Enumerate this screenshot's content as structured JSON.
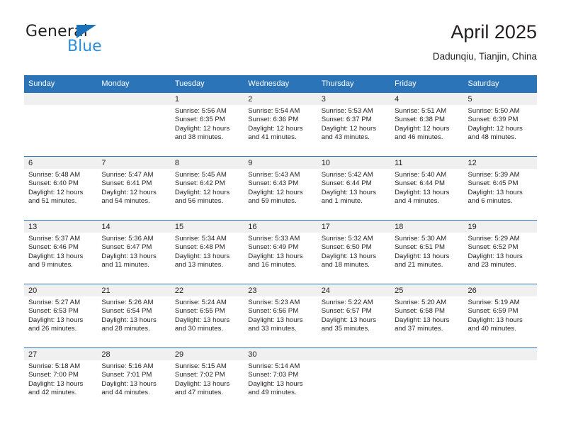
{
  "brand": {
    "name_top": "General",
    "name_bottom": "Blue",
    "triangle_color": "#1b72b8",
    "blue_color": "#2e8fd6"
  },
  "header": {
    "title": "April 2025",
    "subtitle": "Dadunqiu, Tianjin, China"
  },
  "theme": {
    "header_blue": "#2b74b8",
    "daynum_band": "#f0f0f0",
    "text": "#231f20"
  },
  "calendar": {
    "weekday_headers": [
      "Sunday",
      "Monday",
      "Tuesday",
      "Wednesday",
      "Thursday",
      "Friday",
      "Saturday"
    ],
    "labels": {
      "sunrise": "Sunrise:",
      "sunset": "Sunset:",
      "daylight": "Daylight:"
    },
    "weeks": [
      [
        {
          "day": "",
          "sunrise": "",
          "sunset": "",
          "daylight": ""
        },
        {
          "day": "",
          "sunrise": "",
          "sunset": "",
          "daylight": ""
        },
        {
          "day": "1",
          "sunrise": "Sunrise: 5:56 AM",
          "sunset": "Sunset: 6:35 PM",
          "daylight": "Daylight: 12 hours and 38 minutes."
        },
        {
          "day": "2",
          "sunrise": "Sunrise: 5:54 AM",
          "sunset": "Sunset: 6:36 PM",
          "daylight": "Daylight: 12 hours and 41 minutes."
        },
        {
          "day": "3",
          "sunrise": "Sunrise: 5:53 AM",
          "sunset": "Sunset: 6:37 PM",
          "daylight": "Daylight: 12 hours and 43 minutes."
        },
        {
          "day": "4",
          "sunrise": "Sunrise: 5:51 AM",
          "sunset": "Sunset: 6:38 PM",
          "daylight": "Daylight: 12 hours and 46 minutes."
        },
        {
          "day": "5",
          "sunrise": "Sunrise: 5:50 AM",
          "sunset": "Sunset: 6:39 PM",
          "daylight": "Daylight: 12 hours and 48 minutes."
        }
      ],
      [
        {
          "day": "6",
          "sunrise": "Sunrise: 5:48 AM",
          "sunset": "Sunset: 6:40 PM",
          "daylight": "Daylight: 12 hours and 51 minutes."
        },
        {
          "day": "7",
          "sunrise": "Sunrise: 5:47 AM",
          "sunset": "Sunset: 6:41 PM",
          "daylight": "Daylight: 12 hours and 54 minutes."
        },
        {
          "day": "8",
          "sunrise": "Sunrise: 5:45 AM",
          "sunset": "Sunset: 6:42 PM",
          "daylight": "Daylight: 12 hours and 56 minutes."
        },
        {
          "day": "9",
          "sunrise": "Sunrise: 5:43 AM",
          "sunset": "Sunset: 6:43 PM",
          "daylight": "Daylight: 12 hours and 59 minutes."
        },
        {
          "day": "10",
          "sunrise": "Sunrise: 5:42 AM",
          "sunset": "Sunset: 6:44 PM",
          "daylight": "Daylight: 13 hours and 1 minute."
        },
        {
          "day": "11",
          "sunrise": "Sunrise: 5:40 AM",
          "sunset": "Sunset: 6:44 PM",
          "daylight": "Daylight: 13 hours and 4 minutes."
        },
        {
          "day": "12",
          "sunrise": "Sunrise: 5:39 AM",
          "sunset": "Sunset: 6:45 PM",
          "daylight": "Daylight: 13 hours and 6 minutes."
        }
      ],
      [
        {
          "day": "13",
          "sunrise": "Sunrise: 5:37 AM",
          "sunset": "Sunset: 6:46 PM",
          "daylight": "Daylight: 13 hours and 9 minutes."
        },
        {
          "day": "14",
          "sunrise": "Sunrise: 5:36 AM",
          "sunset": "Sunset: 6:47 PM",
          "daylight": "Daylight: 13 hours and 11 minutes."
        },
        {
          "day": "15",
          "sunrise": "Sunrise: 5:34 AM",
          "sunset": "Sunset: 6:48 PM",
          "daylight": "Daylight: 13 hours and 13 minutes."
        },
        {
          "day": "16",
          "sunrise": "Sunrise: 5:33 AM",
          "sunset": "Sunset: 6:49 PM",
          "daylight": "Daylight: 13 hours and 16 minutes."
        },
        {
          "day": "17",
          "sunrise": "Sunrise: 5:32 AM",
          "sunset": "Sunset: 6:50 PM",
          "daylight": "Daylight: 13 hours and 18 minutes."
        },
        {
          "day": "18",
          "sunrise": "Sunrise: 5:30 AM",
          "sunset": "Sunset: 6:51 PM",
          "daylight": "Daylight: 13 hours and 21 minutes."
        },
        {
          "day": "19",
          "sunrise": "Sunrise: 5:29 AM",
          "sunset": "Sunset: 6:52 PM",
          "daylight": "Daylight: 13 hours and 23 minutes."
        }
      ],
      [
        {
          "day": "20",
          "sunrise": "Sunrise: 5:27 AM",
          "sunset": "Sunset: 6:53 PM",
          "daylight": "Daylight: 13 hours and 26 minutes."
        },
        {
          "day": "21",
          "sunrise": "Sunrise: 5:26 AM",
          "sunset": "Sunset: 6:54 PM",
          "daylight": "Daylight: 13 hours and 28 minutes."
        },
        {
          "day": "22",
          "sunrise": "Sunrise: 5:24 AM",
          "sunset": "Sunset: 6:55 PM",
          "daylight": "Daylight: 13 hours and 30 minutes."
        },
        {
          "day": "23",
          "sunrise": "Sunrise: 5:23 AM",
          "sunset": "Sunset: 6:56 PM",
          "daylight": "Daylight: 13 hours and 33 minutes."
        },
        {
          "day": "24",
          "sunrise": "Sunrise: 5:22 AM",
          "sunset": "Sunset: 6:57 PM",
          "daylight": "Daylight: 13 hours and 35 minutes."
        },
        {
          "day": "25",
          "sunrise": "Sunrise: 5:20 AM",
          "sunset": "Sunset: 6:58 PM",
          "daylight": "Daylight: 13 hours and 37 minutes."
        },
        {
          "day": "26",
          "sunrise": "Sunrise: 5:19 AM",
          "sunset": "Sunset: 6:59 PM",
          "daylight": "Daylight: 13 hours and 40 minutes."
        }
      ],
      [
        {
          "day": "27",
          "sunrise": "Sunrise: 5:18 AM",
          "sunset": "Sunset: 7:00 PM",
          "daylight": "Daylight: 13 hours and 42 minutes."
        },
        {
          "day": "28",
          "sunrise": "Sunrise: 5:16 AM",
          "sunset": "Sunset: 7:01 PM",
          "daylight": "Daylight: 13 hours and 44 minutes."
        },
        {
          "day": "29",
          "sunrise": "Sunrise: 5:15 AM",
          "sunset": "Sunset: 7:02 PM",
          "daylight": "Daylight: 13 hours and 47 minutes."
        },
        {
          "day": "30",
          "sunrise": "Sunrise: 5:14 AM",
          "sunset": "Sunset: 7:03 PM",
          "daylight": "Daylight: 13 hours and 49 minutes."
        },
        {
          "day": "",
          "sunrise": "",
          "sunset": "",
          "daylight": ""
        },
        {
          "day": "",
          "sunrise": "",
          "sunset": "",
          "daylight": ""
        },
        {
          "day": "",
          "sunrise": "",
          "sunset": "",
          "daylight": ""
        }
      ]
    ]
  }
}
